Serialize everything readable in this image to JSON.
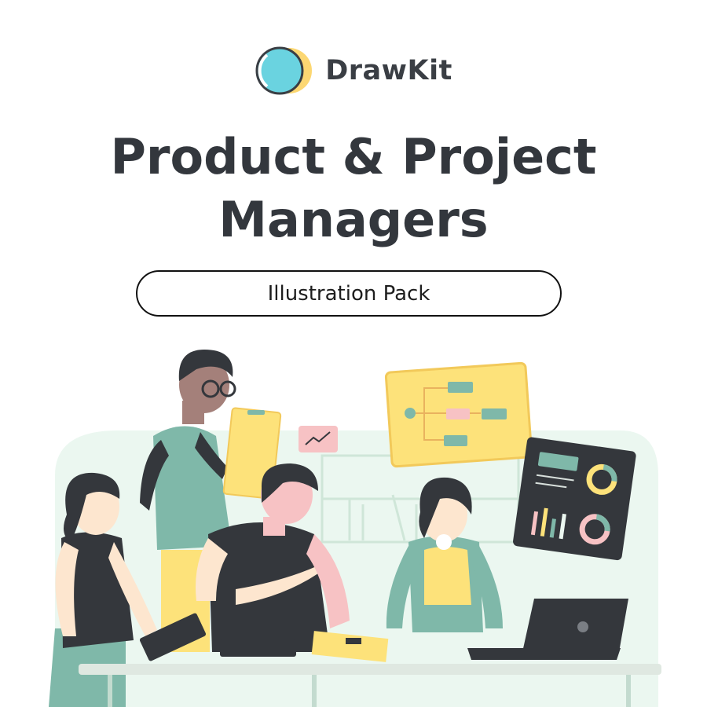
{
  "brand": {
    "name": "DrawKit",
    "logo_colors": {
      "cyan": "#6ad3e0",
      "yellow": "#fcd772",
      "outline": "#3a3e44"
    }
  },
  "title": {
    "line1": "Product & Project",
    "line2": "Managers"
  },
  "subtitle_badge": "Illustration Pack",
  "palette": {
    "mint": "#e9f6ef",
    "teal": "#7fb8a9",
    "yellow": "#fde27a",
    "pink": "#f7c2c4",
    "skin_light": "#fde6cf",
    "skin_brown": "#a4807a",
    "dark": "#34373c",
    "desk": "#dfe8e1"
  },
  "illustration_icons": [
    "flowchart-board-icon",
    "trend-chart-icon",
    "dashboard-monitor-icon",
    "laptop-icon",
    "clipboard-icon",
    "tablet-icon"
  ]
}
